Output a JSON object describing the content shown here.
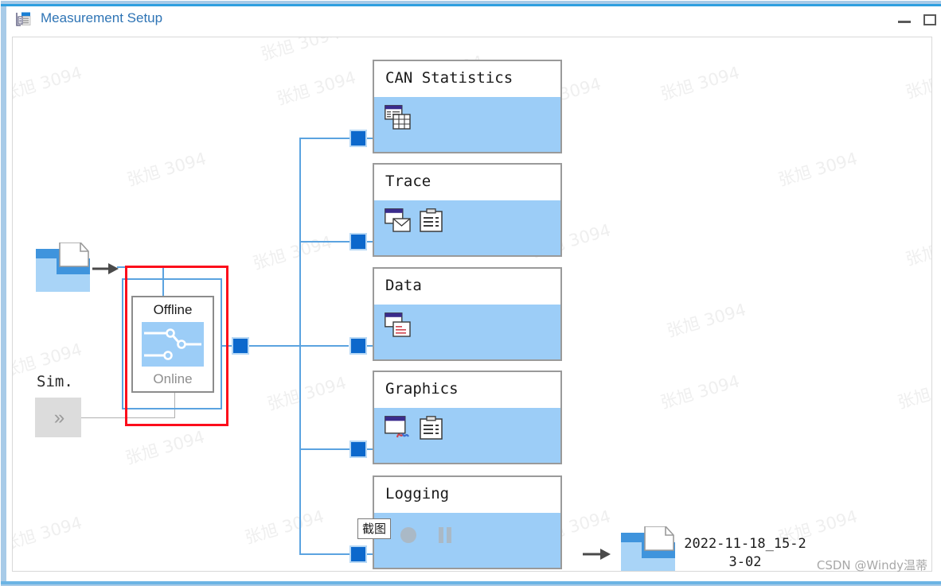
{
  "window": {
    "title": "Measurement Setup",
    "icon": "measurement-setup-icon",
    "minimize_label": "—",
    "maximize_label": "❑"
  },
  "diagram": {
    "source": {
      "icon": "folder-with-file-icon",
      "arrow": "arrow-right-icon"
    },
    "sim": {
      "label": "Sim.",
      "button_label": "››"
    },
    "selector": {
      "offline_label": "Offline",
      "online_label": "Online",
      "active": "Offline",
      "icon": "switch-routing-icon",
      "selection_color": "#fc0d1b",
      "highlight_color": "#5ba3e0"
    },
    "bus_connector": {
      "name": "bus-connector-node",
      "color": "#0c68cc"
    },
    "nodes": [
      {
        "title": "CAN Statistics",
        "icons": [
          "statistics-table-icon"
        ],
        "connector": "connector-square"
      },
      {
        "title": "Trace",
        "icons": [
          "trace-window-mail-icon",
          "clipboard-list-icon"
        ],
        "connector": "connector-square"
      },
      {
        "title": "Data",
        "icons": [
          "data-window-icon"
        ],
        "connector": "connector-square"
      },
      {
        "title": "Graphics",
        "icons": [
          "graphics-window-curve-icon",
          "clipboard-list-icon"
        ],
        "connector": "connector-square"
      },
      {
        "title": "Logging",
        "icons": [
          "record-dot-icon",
          "pause-icon"
        ],
        "connector": "connector-square"
      }
    ],
    "output": {
      "icon": "folder-with-file-icon",
      "arrow": "arrow-right-icon",
      "filename_line1": "2022-11-18_15-2",
      "filename_line2": "3-02"
    },
    "tooltip": {
      "text": "截图"
    }
  },
  "watermarks": {
    "tiles": [
      "张旭 3094",
      "张旭 3094",
      "张旭 3094",
      "张旭 3094",
      "张旭 3094",
      "张旭 3094",
      "张旭 3094",
      "张旭 3094",
      "张旭 3094",
      "张旭 3094",
      "张旭 3094",
      "张旭 3094",
      "张旭 3094",
      "张旭 3094",
      "张旭 3094",
      "张旭 3094",
      "张旭 3094",
      "张旭 3094",
      "张旭 3094",
      "张旭 3094",
      "张旭 3094",
      "张旭 3094",
      "张旭 3094",
      "张旭 3094"
    ],
    "credit": "CSDN @Windy温蒂"
  }
}
